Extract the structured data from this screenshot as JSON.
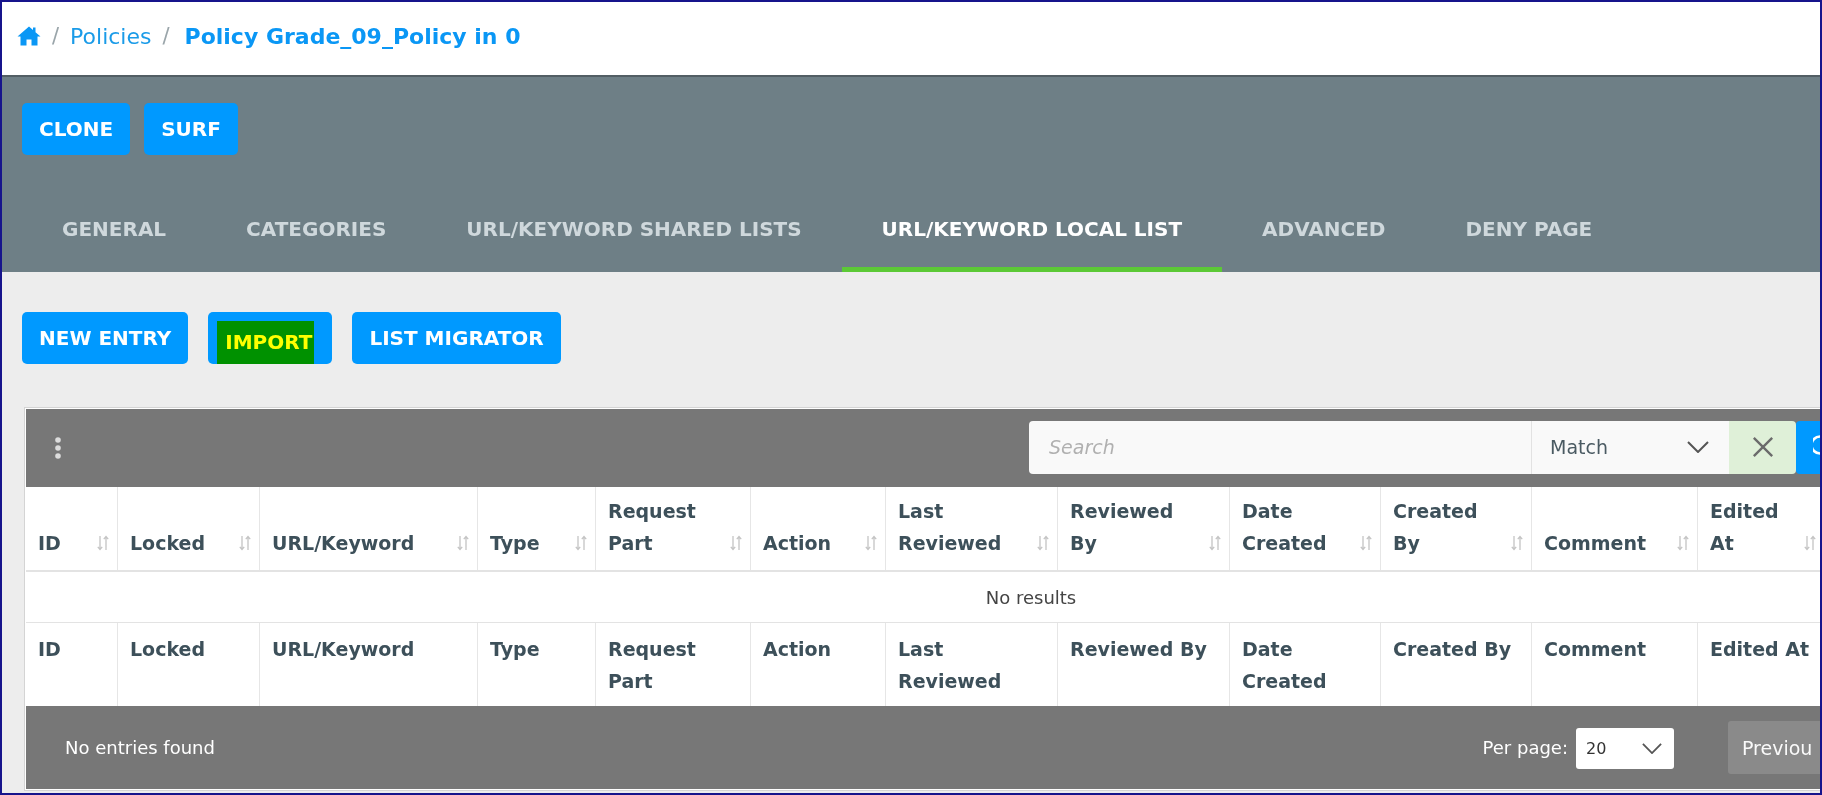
{
  "breadcrumb": [
    {
      "kind": "home"
    },
    {
      "kind": "separator",
      "label": "/"
    },
    {
      "kind": "link",
      "label": "Policies"
    },
    {
      "kind": "separator",
      "label": "/"
    },
    {
      "kind": "current",
      "label": "Policy Grade_09_Policy in 0"
    }
  ],
  "page_actions": [
    {
      "label": "CLONE"
    },
    {
      "label": "SURF"
    }
  ],
  "tabs": [
    {
      "label": "GENERAL",
      "selected": false
    },
    {
      "label": "CATEGORIES",
      "selected": false
    },
    {
      "label": "URL/KEYWORD SHARED LISTS",
      "selected": false
    },
    {
      "label": "URL/KEYWORD LOCAL LIST",
      "selected": true
    },
    {
      "label": "ADVANCED",
      "selected": false
    },
    {
      "label": "DENY PAGE",
      "selected": false
    }
  ],
  "list_actions": [
    {
      "label": "NEW ENTRY",
      "highlighted": false
    },
    {
      "label": "IMPORT",
      "highlighted": true
    },
    {
      "label": "LIST MIGRATOR",
      "highlighted": false
    }
  ],
  "table": {
    "search": {
      "placeholder": "Search"
    },
    "match_select": {
      "value": "Match"
    },
    "columns": [
      {
        "label": "ID"
      },
      {
        "label": "Locked"
      },
      {
        "label": "URL/Keyword"
      },
      {
        "label": "Type"
      },
      {
        "label": "Request Part"
      },
      {
        "label": "Action"
      },
      {
        "label": "Last Reviewed"
      },
      {
        "label": "Reviewed By"
      },
      {
        "label": "Date Created"
      },
      {
        "label": "Created By"
      },
      {
        "label": "Comment"
      },
      {
        "label": "Edited At"
      }
    ],
    "empty_message": "No results",
    "footer_columns": [
      {
        "label": "ID"
      },
      {
        "label": "Locked"
      },
      {
        "label": "URL/Keyword"
      },
      {
        "label": "Type"
      },
      {
        "label": "Request Part"
      },
      {
        "label": "Action"
      },
      {
        "label": "Last Reviewed"
      },
      {
        "label": "Reviewed By"
      },
      {
        "label": "Date Created"
      },
      {
        "label": "Created By"
      },
      {
        "label": "Comment"
      },
      {
        "label": "Edited At"
      }
    ],
    "footer": {
      "status": "No entries found",
      "per_page_label": "Per page:",
      "per_page_value": "20",
      "previous_button": {
        "label": "Previou",
        "disabled": true
      }
    }
  }
}
